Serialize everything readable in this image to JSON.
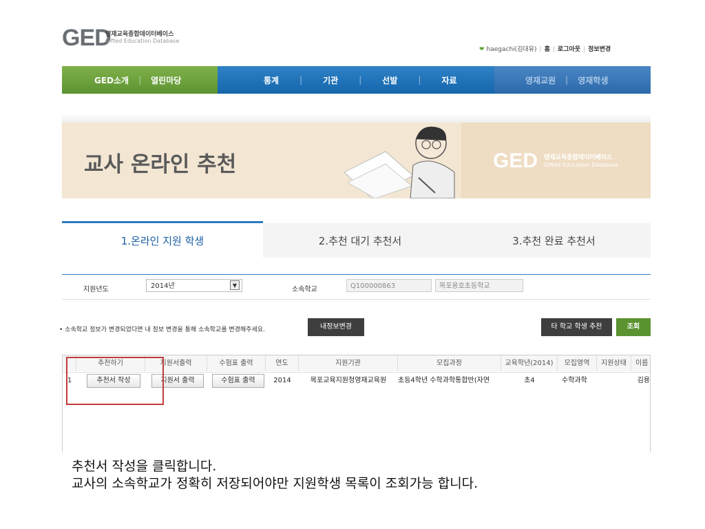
{
  "header": {
    "logo": "GED",
    "logo_sub_ko": "영재교육종합데이터베이스",
    "logo_sub_en": "Gifted Education Database",
    "user": "haegachi(김대유)",
    "links": [
      "홈",
      "로그아웃",
      "정보변경"
    ]
  },
  "nav": {
    "green": [
      "GED소개",
      "열린마당"
    ],
    "blue": [
      "통계",
      "기관",
      "선발",
      "자료"
    ],
    "blue2": [
      "영재교원",
      "영재학생"
    ]
  },
  "banner": {
    "title": "교사 온라인 추천",
    "logo": "GED",
    "logo_sub_ko": "영재교육종합데이터베이스",
    "logo_sub_en": "Gifted Education Database"
  },
  "tabs": [
    "1.온라인 지원 학생",
    "2.추천 대기 추천서",
    "3.추천 완료 추천서"
  ],
  "filter": {
    "year_label": "지원년도",
    "year_value": "2014년",
    "school_label": "소속학교",
    "school_code": "Q100000863",
    "school_name": "목포용호초등학교"
  },
  "notice": {
    "text": "• 소속학교 정보가 변경되었다면 내 정보 변경을 통해 소속학교를 변경해주세요.",
    "my_info_btn": "내정보변경",
    "other_school_btn": "타 학교 학생 추천",
    "search_btn": "조회"
  },
  "table": {
    "headers": [
      "추천하기",
      "지원서출력",
      "수험표 출력",
      "연도",
      "지원기관",
      "모집과정",
      "교육학년(2014)",
      "모집영역",
      "지원상태",
      "이름"
    ],
    "rows": [
      {
        "no": "1",
        "recommend_btn": "추천서 작성",
        "app_print_btn": "지원서 출력",
        "ticket_btn": "수험표 출력",
        "year": "2014",
        "institution": "목포교육지원청영재교육원",
        "course": "초등4학년 수학과학통합반(자연",
        "grade": "초4",
        "area": "수학과학",
        "status": "",
        "name": "김용"
      }
    ]
  },
  "instructions": [
    "추천서 작성을 클릭합니다.",
    "교사의 소속학교가 정확히 저장되어야만 지원학생 목록이 조회가능 합니다."
  ],
  "colors": {
    "green": "#5c9331",
    "blue": "#1566ad",
    "highlight": "#c23a3a"
  }
}
